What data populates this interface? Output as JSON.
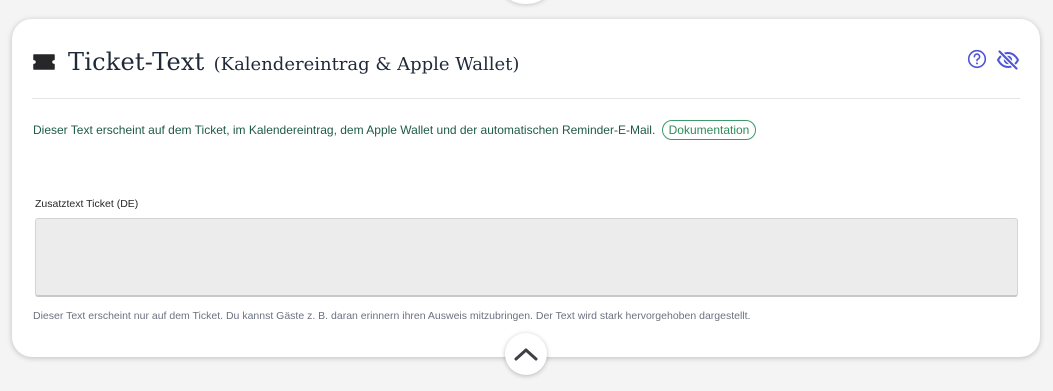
{
  "card": {
    "title": "Ticket-Text",
    "subtitle": "(Kalendereintrag & Apple Wallet)",
    "icons": {
      "ticket": "ticket-icon",
      "help": "help-circle-icon",
      "visibility": "eye-off-icon",
      "collapse": "chevron-up-icon"
    },
    "intro_text": "Dieser Text erscheint auf dem Ticket, im Kalendereintrag, dem Apple Wallet und der automatischen Reminder-E-Mail.",
    "doc_link_label": "Dokumentation",
    "field": {
      "label": "Zusatztext Ticket (DE)",
      "value": "",
      "hint": "Dieser Text erscheint nur auf dem Ticket. Du kannst Gäste z. B. daran erinnern ihren Ausweis mitzubringen. Der Text wird stark hervorgehoben dargestellt."
    }
  },
  "colors": {
    "accent_blue": "#4f56d6",
    "intro_text": "#1e5a46",
    "link_green": "#3f9a6a",
    "title": "#1f2937",
    "field_background": "#ececec"
  }
}
